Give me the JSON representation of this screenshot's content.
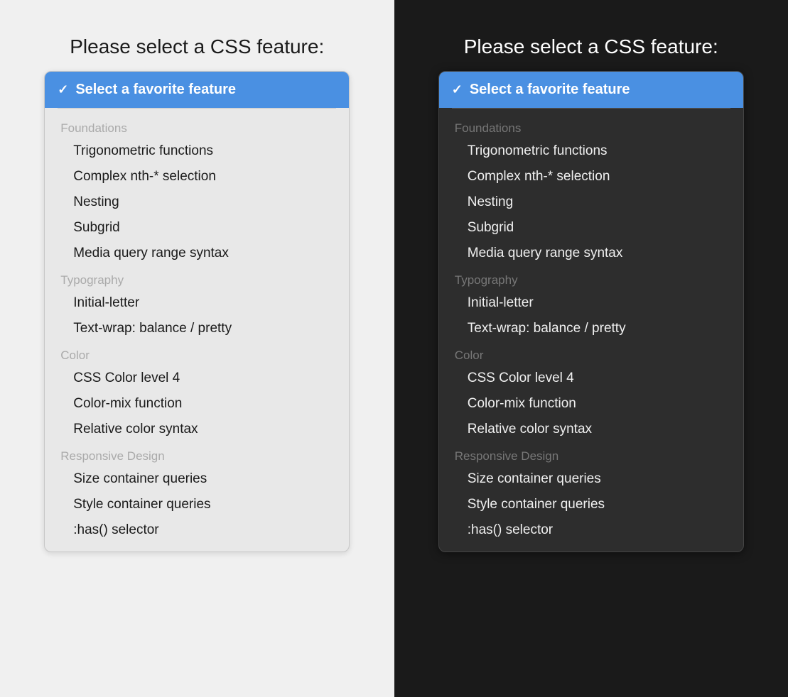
{
  "light": {
    "title": "Please select a CSS feature:",
    "selected_label": "Select a favorite feature",
    "checkmark": "✓",
    "groups": [
      {
        "label": "Foundations",
        "items": [
          "Trigonometric functions",
          "Complex nth-* selection",
          "Nesting",
          "Subgrid",
          "Media query range syntax"
        ]
      },
      {
        "label": "Typography",
        "items": [
          "Initial-letter",
          "Text-wrap: balance / pretty"
        ]
      },
      {
        "label": "Color",
        "items": [
          "CSS Color level 4",
          "Color-mix function",
          "Relative color syntax"
        ]
      },
      {
        "label": "Responsive Design",
        "items": [
          "Size container queries",
          "Style container queries",
          ":has() selector"
        ]
      }
    ]
  },
  "dark": {
    "title": "Please select a CSS feature:",
    "selected_label": "Select a favorite feature",
    "checkmark": "✓",
    "groups": [
      {
        "label": "Foundations",
        "items": [
          "Trigonometric functions",
          "Complex nth-* selection",
          "Nesting",
          "Subgrid",
          "Media query range syntax"
        ]
      },
      {
        "label": "Typography",
        "items": [
          "Initial-letter",
          "Text-wrap: balance / pretty"
        ]
      },
      {
        "label": "Color",
        "items": [
          "CSS Color level 4",
          "Color-mix function",
          "Relative color syntax"
        ]
      },
      {
        "label": "Responsive Design",
        "items": [
          "Size container queries",
          "Style container queries",
          ":has() selector"
        ]
      }
    ]
  }
}
